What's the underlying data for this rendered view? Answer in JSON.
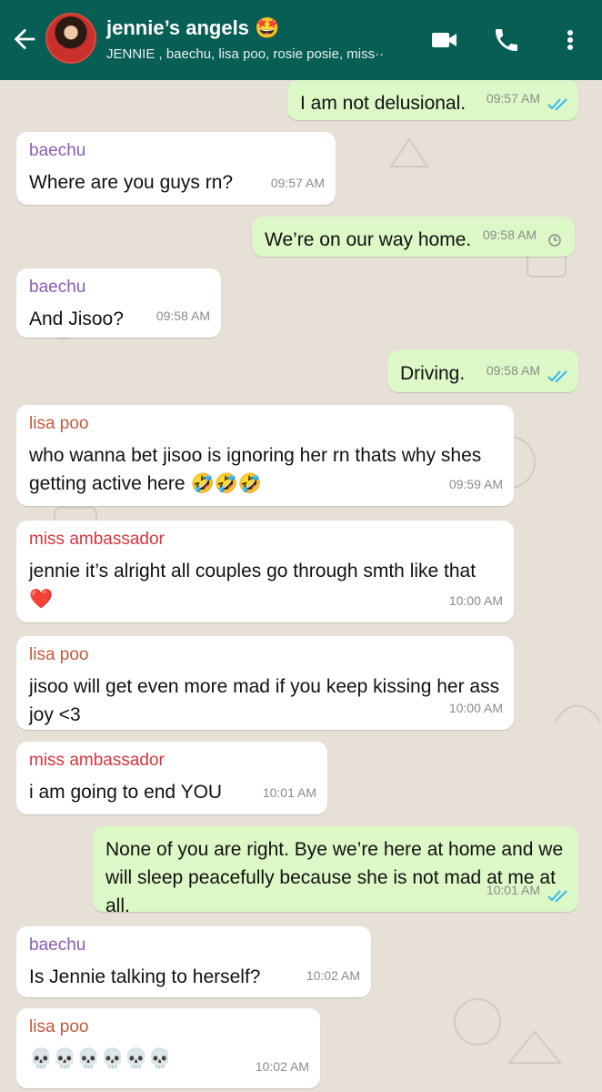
{
  "header": {
    "title": "jennie’s angels 🤩",
    "subtitle": "JENNIE , baechu, lisa poo, rosie posie, miss··",
    "icons": [
      "back-arrow-icon",
      "video-call-icon",
      "phone-icon",
      "more-vert-icon"
    ]
  },
  "messages": [
    {
      "sender": "",
      "text": "I am not delusional.",
      "time": "09:57 AM",
      "status": "read"
    },
    {
      "sender": "baechu",
      "text": "Where are you guys rn?",
      "time": "09:57 AM"
    },
    {
      "sender": "",
      "text": "We’re on our way home.",
      "time": "09:58 AM",
      "status": "pending"
    },
    {
      "sender": "baechu",
      "text": "And Jisoo?",
      "time": "09:58 AM"
    },
    {
      "sender": "",
      "text": "Driving.",
      "time": "09:58 AM",
      "status": "read"
    },
    {
      "sender": "lisa poo",
      "text": "who wanna bet jisoo is ignoring her rn thats why shes getting active here 🤣🤣🤣",
      "time": "09:59 AM"
    },
    {
      "sender": "miss ambassador",
      "text": "jennie it’s alright all couples go through smth like that ❤️",
      "time": "10:00 AM"
    },
    {
      "sender": "lisa poo",
      "text": "jisoo will get even more mad if you keep kissing her ass joy <3",
      "time": "10:00 AM"
    },
    {
      "sender": "miss ambassador",
      "text": "i am going to end YOU",
      "time": "10:01 AM"
    },
    {
      "sender": "",
      "text": "None of you are right. Bye we’re here at home and we will sleep peacefully because she is not mad at me at all.",
      "time": "10:01 AM",
      "status": "read"
    },
    {
      "sender": "baechu",
      "text": "Is Jennie talking to herself?",
      "time": "10:02 AM"
    },
    {
      "sender": "lisa poo",
      "text": "💀💀💀💀💀💀",
      "time": "10:02 AM"
    }
  ],
  "colors": {
    "header": "#075e54",
    "outgoing": "#dcf8c6",
    "incoming": "#ffffff",
    "baechu": "#8a5db5",
    "lisa_poo": "#c05b3d",
    "miss_ambassador": "#d8353f",
    "read_tick": "#34b7f1"
  }
}
